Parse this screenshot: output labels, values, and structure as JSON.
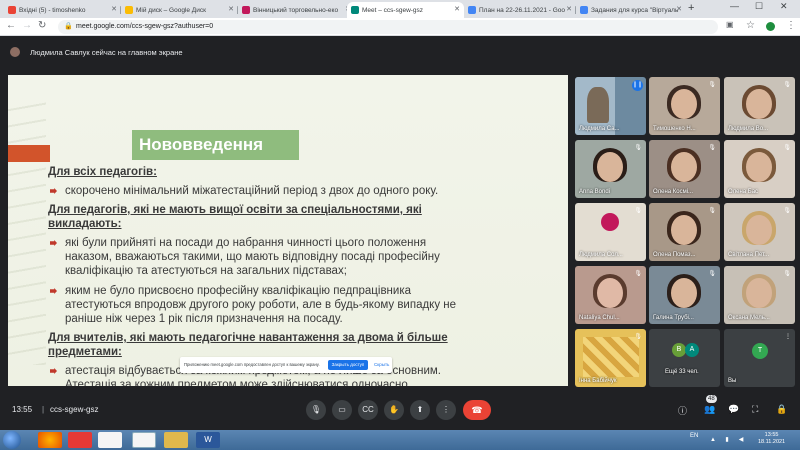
{
  "browser": {
    "tabs": [
      {
        "label": "Вхідні (5) - timoshenko",
        "color": "#ea4335"
      },
      {
        "label": "Мій диск – Google Диск",
        "color": "#fbbc04"
      },
      {
        "label": "Вінницький торговельно-еко",
        "color": "#c2185b"
      },
      {
        "label": "Meet – ccs-sgew-gsz",
        "color": "#00897b"
      },
      {
        "label": "План на 22-26.11.2021 - Goo",
        "color": "#4285f4"
      },
      {
        "label": "Задания для курса \"Віртуаль",
        "color": "#4285f4"
      }
    ],
    "new_tab": "+",
    "window_controls": {
      "minimize": "—",
      "maximize": "☐",
      "close": "✕"
    },
    "url": "meet.google.com/ccs-sgew-gsz?authuser=0"
  },
  "meet": {
    "presenter_banner": "Людмила Савлук сейчас на главном экране",
    "meeting_time": "13:55",
    "meeting_separator": "|",
    "meeting_code": "ccs-sgew-gsz",
    "participant_count_badge": "48",
    "more_participants": "Ещё 33 чел.",
    "self_label": "Вы",
    "self_initial": "T",
    "more_initials": [
      "В",
      "А"
    ]
  },
  "slide": {
    "title": "Нововведення",
    "heading1": "Для всіх педагогів:",
    "bullet1": "скорочено мінімальний міжатестаційний період з двох до одного року.",
    "heading2_line1": "Для педагогів, які не мають вищої освіти за спеціальностями, які",
    "heading2_line2": "викладають:",
    "bullet2_line1": "які були прийняті на посади до набрання чинності цього положення",
    "bullet2_line2": "наказом, вважаються такими, що мають відповідну посаді професійну",
    "bullet2_line3": "кваліфікацію та атестуються на загальних підставах;",
    "bullet3_line1": "яким не було присвоєно професійну кваліфікацію педпрацівника",
    "bullet3_line2": "атестуються впродовж другого року роботи, але в будь-якому випадку не",
    "bullet3_line3": "раніше ніж через 1 рік після призначення на посаду.",
    "heading3_line1": "Для вчителів, які мають педагогічне навантаження за двома й більше",
    "heading3_line2": "предметами:",
    "bullet4_line1": "атестація відбувається за кожним предметом, а не лише за основним.",
    "bullet4_line2": "Атестація за кожним предметом може здійснюватися одночасно."
  },
  "share_notice": {
    "text": "Приложению meet.google.com предоставлен доступ к вашему экрану.",
    "stop_label": "Закрыть доступ",
    "hide_label": "Скрыть"
  },
  "participants": [
    "Людмила Са...",
    "Тимошенко Н...",
    "Людмила Во...",
    "Anna Bondi",
    "Олена Космі...",
    "Олена Бас",
    "Людмила Сол...",
    "Олена Помаз...",
    "Світлана Пет...",
    "Nataliya Chul...",
    "Галина Трубі...",
    "Оксана Мель...",
    "Інна Бабійчук"
  ],
  "taskbar": {
    "language": "EN",
    "time": "13:55",
    "date": "18.11.2021"
  }
}
